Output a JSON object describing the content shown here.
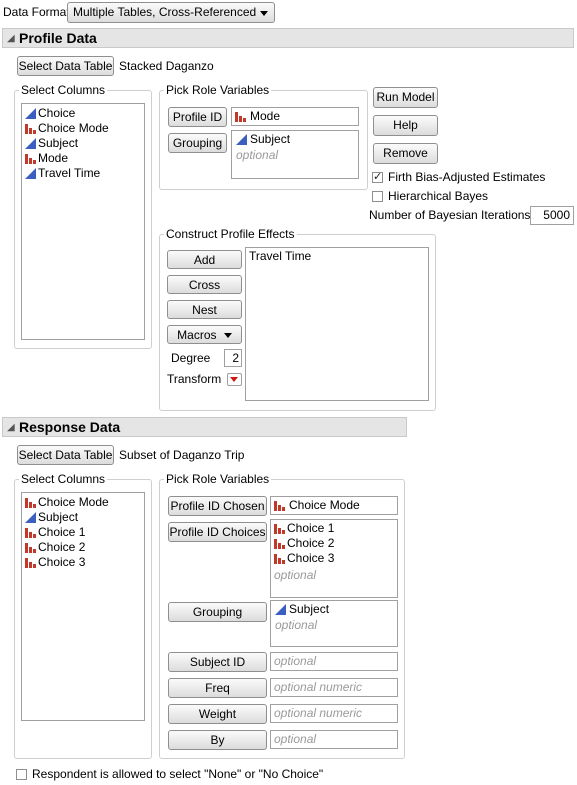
{
  "data_format": {
    "label": "Data Format",
    "value": "Multiple Tables, Cross-Referenced"
  },
  "profile": {
    "title": "Profile Data",
    "select_btn": "Select Data Table",
    "table_name": "Stacked Daganzo",
    "select_columns_title": "Select Columns",
    "columns": [
      {
        "name": "Choice",
        "type": "continuous"
      },
      {
        "name": "Choice Mode",
        "type": "nominal"
      },
      {
        "name": "Subject",
        "type": "continuous"
      },
      {
        "name": "Mode",
        "type": "nominal"
      },
      {
        "name": "Travel Time",
        "type": "continuous"
      }
    ],
    "pick_role_title": "Pick Role Variables",
    "profile_id_btn": "Profile ID",
    "profile_id_value": "Mode",
    "grouping_btn": "Grouping",
    "grouping_value": "Subject",
    "grouping_optional": "optional",
    "run_model": "Run Model",
    "help": "Help",
    "remove": "Remove",
    "firth_label": "Firth Bias-Adjusted Estimates",
    "firth_checked": true,
    "hier_label": "Hierarchical Bayes",
    "hier_checked": false,
    "iterations_label": "Number of Bayesian Iterations",
    "iterations_value": "5000",
    "construct_title": "Construct Profile Effects",
    "add": "Add",
    "cross": "Cross",
    "nest": "Nest",
    "macros": "Macros",
    "degree_label": "Degree",
    "degree_value": "2",
    "transform_label": "Transform",
    "effects": [
      "Travel Time"
    ]
  },
  "response": {
    "title": "Response Data",
    "select_btn": "Select Data Table",
    "table_name": "Subset of Daganzo Trip",
    "select_columns_title": "Select Columns",
    "columns": [
      {
        "name": "Choice Mode",
        "type": "nominal"
      },
      {
        "name": "Subject",
        "type": "continuous"
      },
      {
        "name": "Choice 1",
        "type": "nominal"
      },
      {
        "name": "Choice 2",
        "type": "nominal"
      },
      {
        "name": "Choice 3",
        "type": "nominal"
      }
    ],
    "pick_role_title": "Pick Role Variables",
    "profile_id_chosen_btn": "Profile ID Chosen",
    "profile_id_chosen_value": "Choice Mode",
    "profile_id_choices_btn": "Profile ID Choices",
    "profile_id_choices_values": [
      "Choice 1",
      "Choice 2",
      "Choice 3"
    ],
    "choices_optional": "optional",
    "grouping_btn": "Grouping",
    "grouping_value": "Subject",
    "grouping_optional": "optional",
    "subject_id_btn": "Subject ID",
    "subject_id_placeholder": "optional",
    "freq_btn": "Freq",
    "freq_placeholder": "optional numeric",
    "weight_btn": "Weight",
    "weight_placeholder": "optional numeric",
    "by_btn": "By",
    "by_placeholder": "optional"
  },
  "none_choice_label": "Respondent is allowed to select \"None\" or \"No Choice\"",
  "none_choice_checked": false,
  "icon_colors": {
    "continuous": "#3b5fc0",
    "nominal": "#c0392b"
  }
}
